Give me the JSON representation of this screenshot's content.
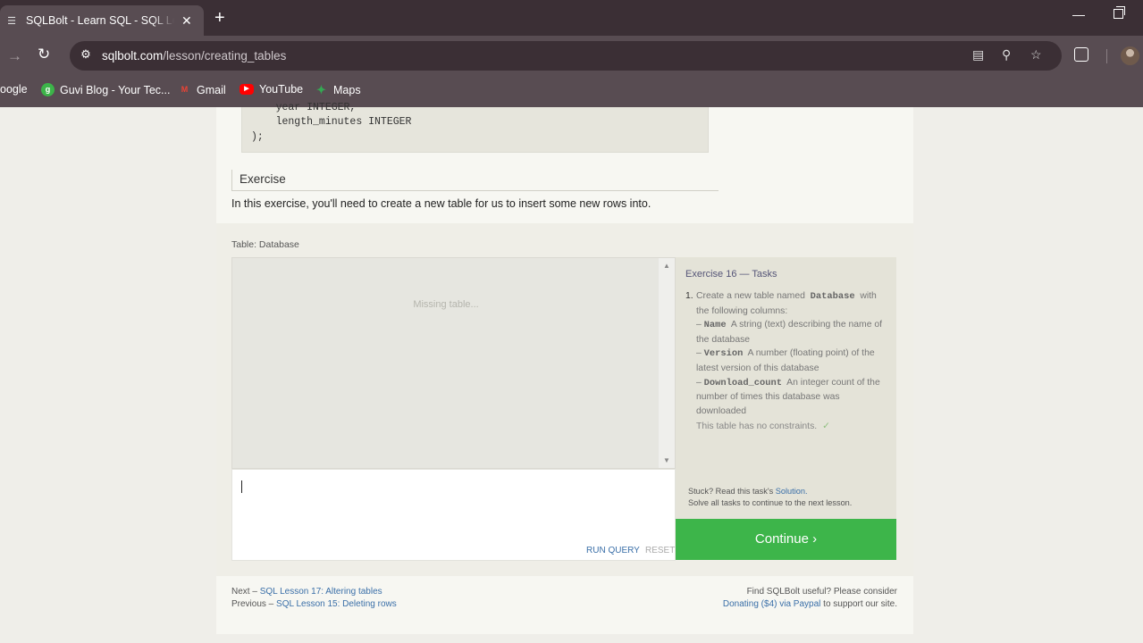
{
  "browser": {
    "tab_title": "SQLBolt - Learn SQL - SQL Lesson",
    "url_host": "sqlbolt.com",
    "url_path": "/lesson/creating_tables",
    "bookmarks": [
      {
        "label": "oogle"
      },
      {
        "label": "Guvi Blog - Your Tec..."
      },
      {
        "label": "Gmail"
      },
      {
        "label": "YouTube"
      },
      {
        "label": "Maps"
      }
    ]
  },
  "lesson": {
    "code_lines": [
      "    year INTEGER,",
      "    length_minutes INTEGER",
      ");"
    ],
    "exercise_heading": "Exercise",
    "exercise_text": "In this exercise, you'll need to create a new table for us to insert some new rows into."
  },
  "exercise": {
    "table_label": "Table: Database",
    "missing_table": "Missing table...",
    "run_query": "RUN QUERY",
    "reset": "RESET",
    "tasks_title": "Exercise 16 — Tasks",
    "task_number": "1.",
    "task_intro_1": "Create a new table named",
    "task_table_name": "Database",
    "task_intro_2": "with the following columns:",
    "columns": [
      {
        "dash": "–",
        "name": "Name",
        "desc": "A string (text) describing the name of the database"
      },
      {
        "dash": "–",
        "name": "Version",
        "desc": "A number (floating point) of the latest version of this database"
      },
      {
        "dash": "–",
        "name": "Download_count",
        "desc": "An integer count of the number of times this database was downloaded"
      }
    ],
    "constraint_text": "This table has no constraints.",
    "check_mark": "✓",
    "stuck_prefix": "Stuck? Read this task's",
    "solution_link": "Solution.",
    "solve_all": "Solve all tasks to continue to the next lesson.",
    "continue_label": "Continue ›"
  },
  "footer": {
    "next_prefix": "Next –",
    "next_link": "SQL Lesson 17: Altering tables",
    "prev_prefix": "Previous –",
    "prev_link": "SQL Lesson 15: Deleting rows",
    "support_text": "Find SQLBolt useful? Please consider",
    "donate_link": "Donating ($4) via Paypal",
    "support_suffix": "to support our site."
  }
}
